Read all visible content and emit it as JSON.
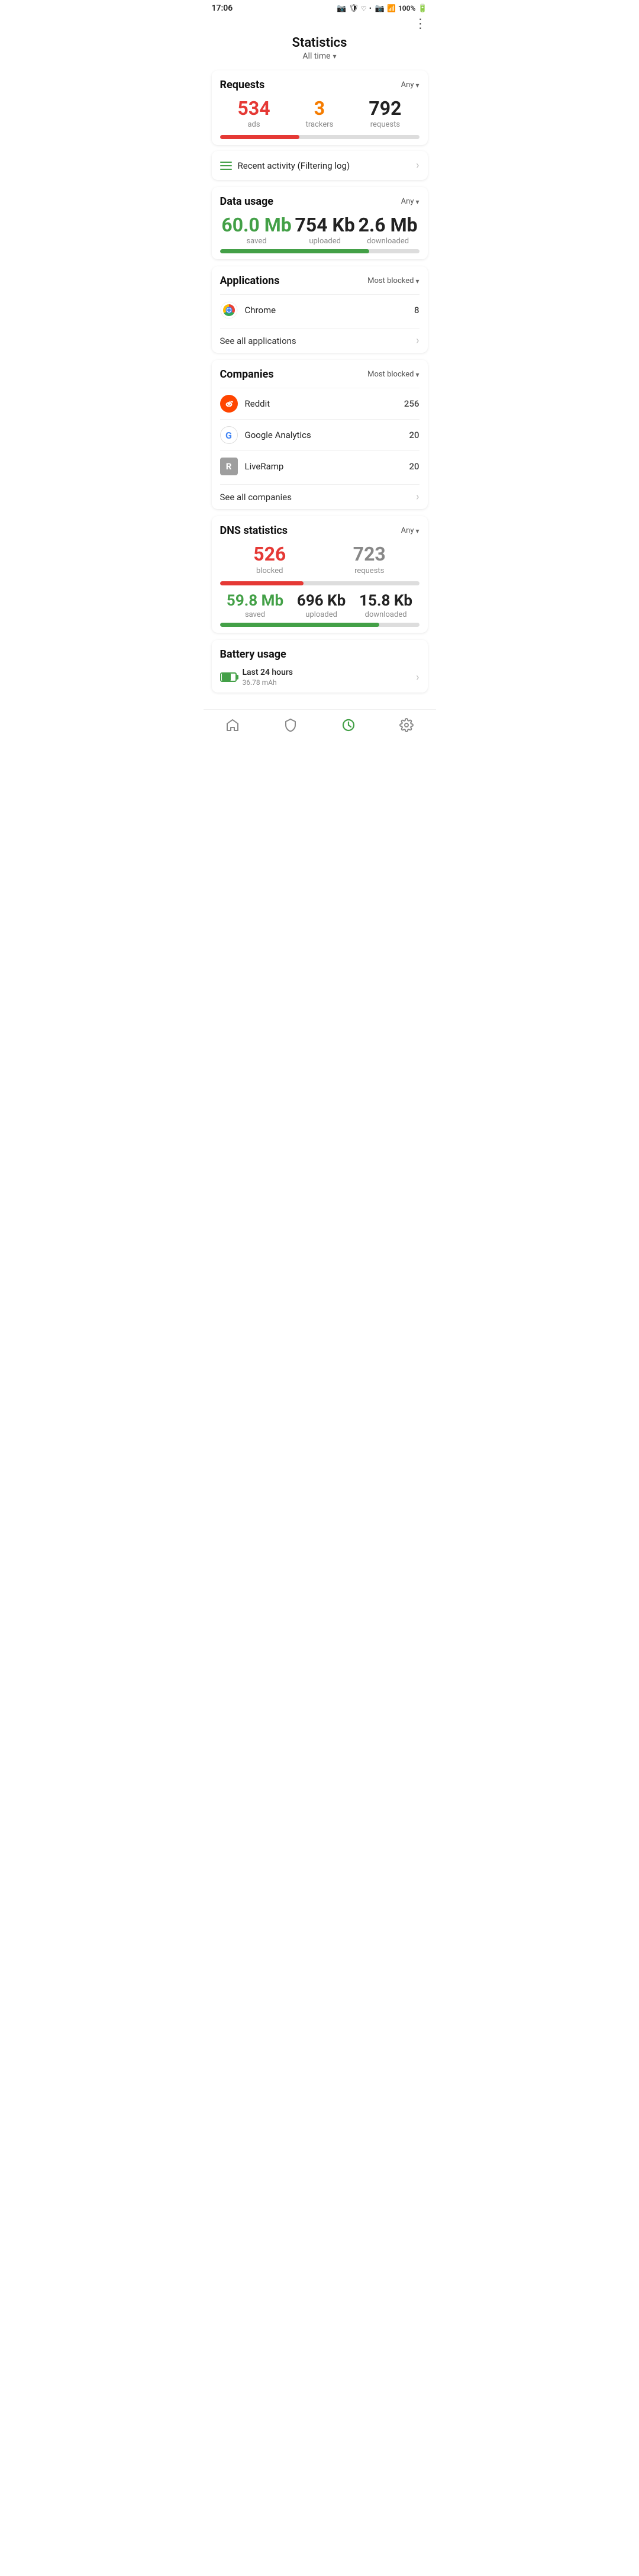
{
  "statusBar": {
    "time": "17:06",
    "battery": "100%"
  },
  "header": {
    "title": "Statistics",
    "subtitle": "All time",
    "menuIcon": "⋮"
  },
  "requests": {
    "sectionTitle": "Requests",
    "filter": "Any",
    "ads": {
      "value": "534",
      "label": "ads"
    },
    "trackers": {
      "value": "3",
      "label": "trackers"
    },
    "requests": {
      "value": "792",
      "label": "requests"
    },
    "progressAdsPercent": 40
  },
  "recentActivity": {
    "label": "Recent activity (Filtering log)"
  },
  "dataUsage": {
    "sectionTitle": "Data usage",
    "filter": "Any",
    "saved": {
      "value": "60.0 Mb",
      "label": "saved"
    },
    "uploaded": {
      "value": "754 Kb",
      "label": "uploaded"
    },
    "downloaded": {
      "value": "2.6 Mb",
      "label": "downloaded"
    },
    "progressPercent": 75
  },
  "applications": {
    "sectionTitle": "Applications",
    "filter": "Most blocked",
    "items": [
      {
        "name": "Chrome",
        "count": "8",
        "icon": "chrome"
      }
    ],
    "seeAll": "See all applications"
  },
  "companies": {
    "sectionTitle": "Companies",
    "filter": "Most blocked",
    "items": [
      {
        "name": "Reddit",
        "count": "256",
        "icon": "reddit"
      },
      {
        "name": "Google Analytics",
        "count": "20",
        "icon": "google"
      },
      {
        "name": "LiveRamp",
        "count": "20",
        "icon": "liveramp"
      }
    ],
    "seeAll": "See all companies"
  },
  "dnsStatistics": {
    "sectionTitle": "DNS statistics",
    "filter": "Any",
    "blocked": {
      "value": "526",
      "label": "blocked"
    },
    "requests": {
      "value": "723",
      "label": "requests"
    },
    "progressPercent": 42,
    "saved": {
      "value": "59.8 Mb",
      "label": "saved"
    },
    "uploaded": {
      "value": "696 Kb",
      "label": "uploaded"
    },
    "downloaded": {
      "value": "15.8 Kb",
      "label": "downloaded"
    },
    "progressDataPercent": 80
  },
  "batteryUsage": {
    "sectionTitle": "Battery usage",
    "period": "Last 24 hours",
    "value": "36.78 mAh"
  },
  "bottomNav": [
    {
      "icon": "home",
      "label": "Home",
      "active": false
    },
    {
      "icon": "shield",
      "label": "Shield",
      "active": false
    },
    {
      "icon": "chart",
      "label": "Stats",
      "active": true
    },
    {
      "icon": "settings",
      "label": "Settings",
      "active": false
    }
  ]
}
